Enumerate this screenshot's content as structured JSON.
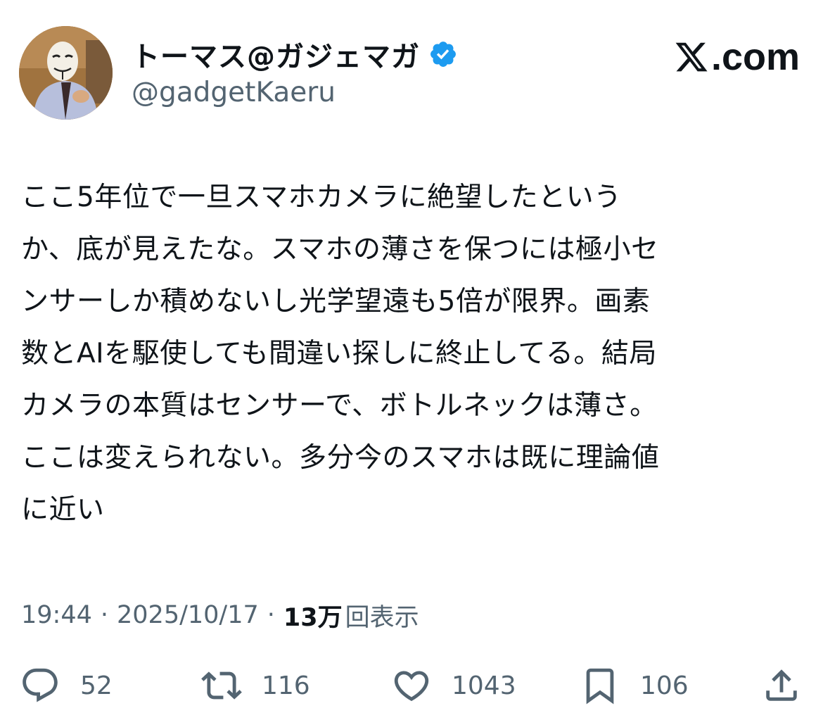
{
  "author": {
    "display_name": "トーマス@ガジェマガ",
    "handle": "@gadgetKaeru",
    "avatar_icon": "avatar-photo-masked-man",
    "verified_icon": "verified-badge-icon",
    "verified_color": "#1d9bf0"
  },
  "brand": {
    "logo_icon": "x-logo-icon",
    "label": ".com"
  },
  "tweet": {
    "text": "ここ5年位で一旦スマホカメラに絶望したという\nか、底が見えたな。スマホの薄さを保つには極小セ\nンサーしか積めないし光学望遠も5倍が限界。画素\n数とAIを駆使しても間違い探しに終止してる。結局\nカメラの本質はセンサーで、ボトルネックは薄さ。\nここは変えられない。多分今のスマホは既に理論値\nに近い"
  },
  "meta": {
    "time": "19:44",
    "separator": "·",
    "date": "2025/10/17",
    "views_count": "13万",
    "views_label": "回表示"
  },
  "actions": {
    "reply": {
      "icon": "reply-icon",
      "count": "52"
    },
    "repost": {
      "icon": "repost-icon",
      "count": "116"
    },
    "like": {
      "icon": "heart-icon",
      "count": "1043"
    },
    "bookmark": {
      "icon": "bookmark-icon",
      "count": "106"
    },
    "share": {
      "icon": "share-icon"
    }
  },
  "colors": {
    "text_primary": "#0f1419",
    "text_secondary": "#536471",
    "verified": "#1d9bf0"
  }
}
